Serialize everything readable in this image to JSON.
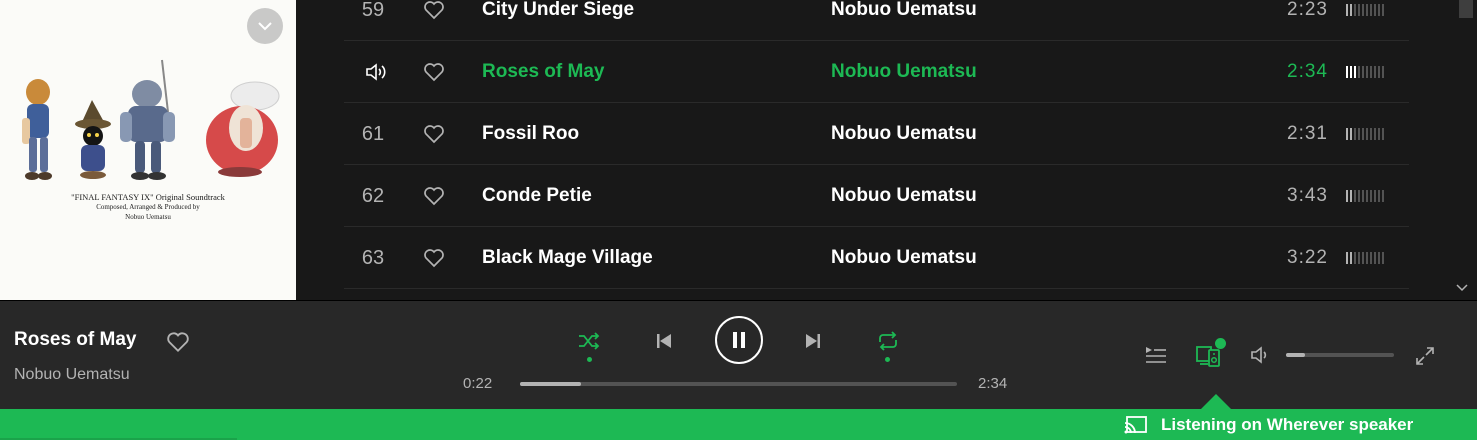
{
  "album": {
    "caption_line1": "\"FINAL FANTASY IX\" Original Soundtrack",
    "caption_line2": "Composed, Arranged & Produced by",
    "caption_line3": "Nobuo Uematsu"
  },
  "tracks": [
    {
      "number": "59",
      "title": "City Under Siege",
      "artist": "Nobuo Uematsu",
      "duration": "2:23",
      "popularity": 0.2
    },
    {
      "number": "",
      "title": "Roses of May",
      "artist": "Nobuo Uematsu",
      "duration": "2:34",
      "popularity": 0.3,
      "playing": true
    },
    {
      "number": "61",
      "title": "Fossil Roo",
      "artist": "Nobuo Uematsu",
      "duration": "2:31",
      "popularity": 0.2
    },
    {
      "number": "62",
      "title": "Conde Petie",
      "artist": "Nobuo Uematsu",
      "duration": "3:43",
      "popularity": 0.2
    },
    {
      "number": "63",
      "title": "Black Mage Village",
      "artist": "Nobuo Uematsu",
      "duration": "3:22",
      "popularity": 0.2
    }
  ],
  "now_playing": {
    "title": "Roses of May",
    "artist": "Nobuo Uematsu",
    "elapsed": "0:22",
    "total": "2:34",
    "progress": 0.14,
    "volume": 0.18,
    "shuffle_on": true,
    "repeat_on": true
  },
  "banner": {
    "prefix": "Listening on ",
    "device": "Wherever speaker"
  },
  "colors": {
    "accent": "#1db954",
    "background": "#181818",
    "bar": "#282828"
  },
  "icons": [
    "chevron-down-icon",
    "speaker-icon",
    "heart-icon",
    "shuffle-icon",
    "previous-icon",
    "pause-icon",
    "next-icon",
    "repeat-icon",
    "queue-icon",
    "devices-icon",
    "volume-icon",
    "fullscreen-icon",
    "cast-icon"
  ]
}
